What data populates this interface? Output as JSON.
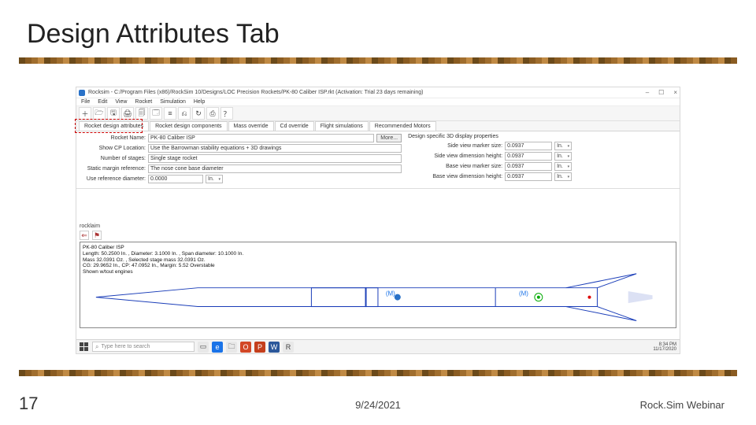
{
  "slide": {
    "title": "Design Attributes Tab",
    "page_number": "17",
    "date": "9/24/2021",
    "footer_right": "Rock.Sim Webinar"
  },
  "window": {
    "title": "Rocksim - C:/Program Files (x86)/RockSim 10/Designs/LOC Precision Rockets/PK-80 Caliber ISP.rkt  (Activation: Trial 23 days remaining)",
    "controls": {
      "min": "–",
      "max": "☐",
      "close": "×"
    }
  },
  "menu": {
    "items": [
      "File",
      "Edit",
      "View",
      "Rocket",
      "Simulation",
      "Help"
    ]
  },
  "toolbar": {
    "icons": [
      "＋",
      "🗁",
      "🖫",
      "🖨",
      "🗐",
      "🗔",
      "≡",
      "⎌",
      "↻",
      "⎙",
      "？"
    ]
  },
  "tabs": {
    "items": [
      "Rocket design attributes",
      "Rocket design components",
      "Mass override",
      "Cd override",
      "Flight simulations",
      "Recommended Motors"
    ],
    "active": 0
  },
  "form": {
    "rocket_name": {
      "label": "Rocket Name:",
      "value": "PK-80 Caliber  ISP"
    },
    "more": "More...",
    "cp_location": {
      "label": "Show CP Location:",
      "value": "Use the Barrowman stability equations + 3D drawings"
    },
    "stages": {
      "label": "Number of stages:",
      "value": "Single stage rocket"
    },
    "margin_ref": {
      "label": "Static margin reference:",
      "value": "The nose cone base diameter"
    },
    "use_ref_diam": {
      "label": "Use reference diameter:",
      "value": "0.0000",
      "unit": "In."
    },
    "right_head": "Design specific 3D display properties",
    "props": [
      {
        "label": "Side view marker size:",
        "value": "0.0937",
        "unit": "In."
      },
      {
        "label": "Side view dimension height:",
        "value": "0.0937",
        "unit": "In."
      },
      {
        "label": "Base view marker size:",
        "value": "0.0937",
        "unit": "In."
      },
      {
        "label": "Base view dimension height:",
        "value": "0.0937",
        "unit": "In."
      }
    ]
  },
  "lower": {
    "rocklaim": "rocklaim",
    "icons": [
      "⇐",
      "⚑"
    ]
  },
  "schematic": {
    "lines": [
      "PK-80 Caliber ISP",
      "Length: 50.2500 In. , Diameter: 3.1000 In. , Span diameter: 10.1000 In.",
      "Mass 32.0391 Oz. , Selected stage mass 32.0391 Oz.",
      "CG: 29.9652 In., CP: 47.0952 In., Margin: 5.52  Overstable",
      "Shown w/tout engines"
    ],
    "cp_label": "(M)",
    "cg_label": "(M)"
  },
  "taskbar": {
    "search_placeholder": "Type here to search",
    "time": "8:34 PM",
    "date": "11/17/2020"
  }
}
